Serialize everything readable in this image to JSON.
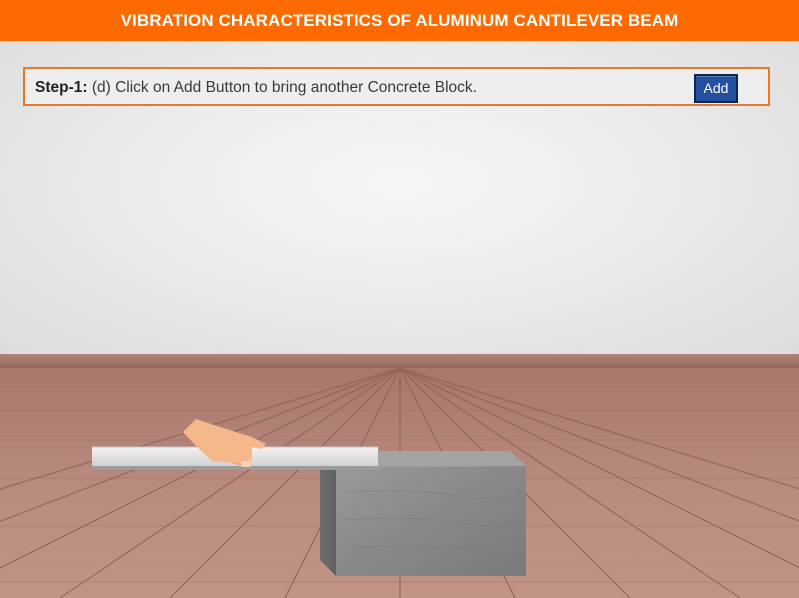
{
  "header": {
    "title": "VIBRATION CHARACTERISTICS OF ALUMINUM CANTILEVER BEAM"
  },
  "instruction": {
    "step_label": "Step-1:",
    "text": " (d) Click on Add Button to bring another Concrete Block.",
    "add_button_label": "Add"
  },
  "colors": {
    "header_bg": "#ff6a00",
    "instruction_border": "#e8782a",
    "add_button_bg": "#2450a0",
    "floor_wood": "#b9877a",
    "concrete": "#8e8e8e",
    "beam": "#d6d6d6",
    "hand": "#f5b889"
  },
  "scene": {
    "objects": [
      "aluminum-beam",
      "concrete-block",
      "hand",
      "wooden-floor",
      "wall"
    ]
  }
}
